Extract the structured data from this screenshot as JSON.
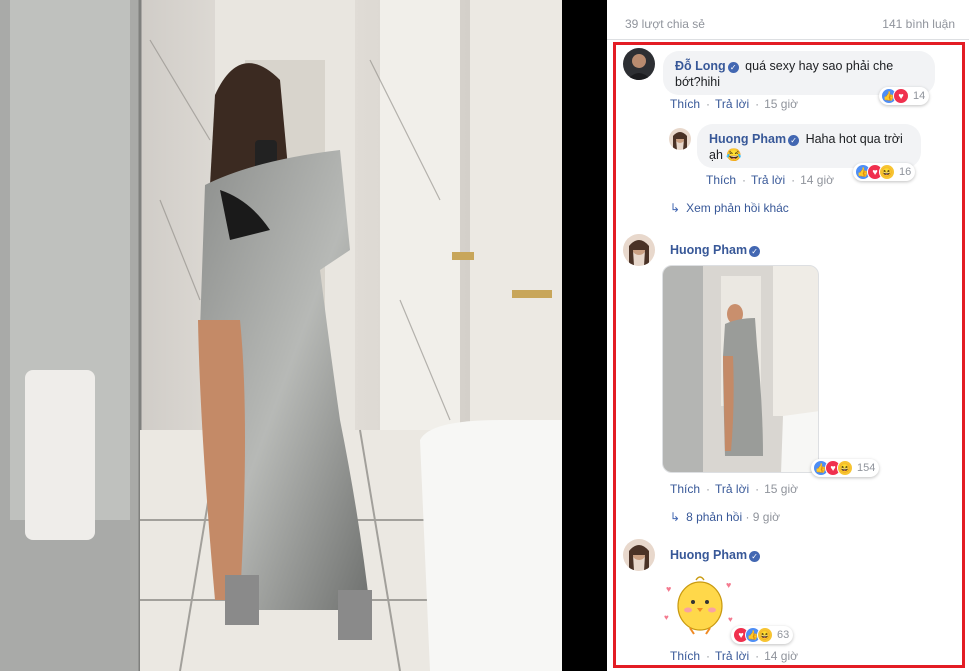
{
  "post": {
    "shares": "39 lượt chia sẻ",
    "comment_count": "141 bình luận"
  },
  "comments": [
    {
      "author": "Đỗ Long",
      "text": "quá sexy hay sao phải che bớt?hihi",
      "text_line1": "quá sexy hay sao phải che",
      "text_line2": "bớt?hihi",
      "like_label": "Thích",
      "reply_label": "Trả lời",
      "time": "15 giờ",
      "reactions": [
        "like",
        "love"
      ],
      "reaction_count": "14",
      "replies": [
        {
          "author": "Huong Pham",
          "text_line1": "Haha hot qua trời",
          "text_line2": "ạh",
          "emoji": "😂",
          "like_label": "Thích",
          "reply_label": "Trả lời",
          "time": "14 giờ",
          "reactions": [
            "like",
            "love",
            "haha"
          ],
          "reaction_count": "16"
        }
      ],
      "more_replies": "Xem phản hồi khác"
    },
    {
      "author": "Huong Pham",
      "attachment": "photo",
      "like_label": "Thích",
      "reply_label": "Trả lời",
      "time": "15 giờ",
      "reactions": [
        "like",
        "love",
        "haha"
      ],
      "reaction_count": "154",
      "replies_label": "8 phản hồi",
      "replies_time": "9 giờ"
    },
    {
      "author": "Huong Pham",
      "attachment": "sticker",
      "like_label": "Thích",
      "reply_label": "Trả lời",
      "time": "14 giờ",
      "reactions": [
        "love",
        "like",
        "haha"
      ],
      "reaction_count": "63"
    }
  ],
  "colors": {
    "highlight": "#e31d24",
    "link": "#385898",
    "verified": "#4267b2"
  }
}
